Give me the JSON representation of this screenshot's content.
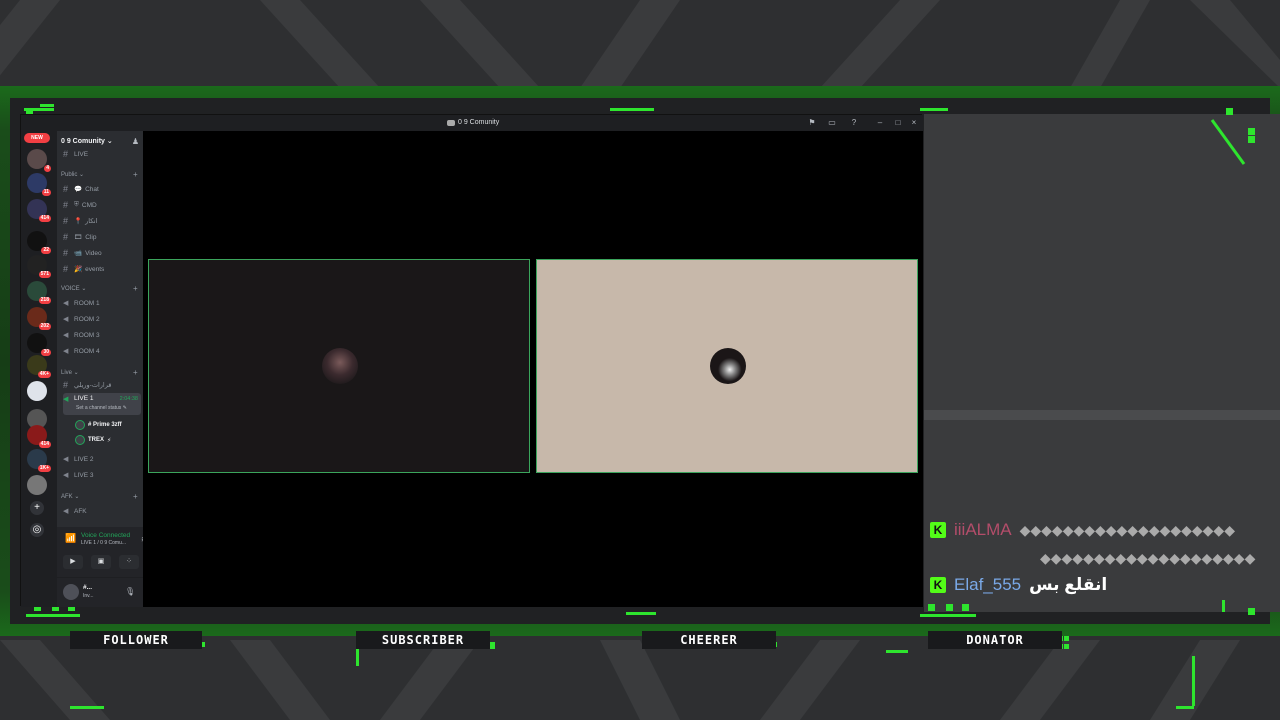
{
  "overlay": {
    "labels": [
      "FOLLOWER",
      "SUBSCRIBER",
      "CHEERER",
      "DONATOR"
    ],
    "accent": "#2ee52e"
  },
  "window": {
    "title": "0 9 Comunity",
    "controls": [
      "flag-icon",
      "inbox-icon",
      "help-icon",
      "minimize-icon",
      "maximize-icon",
      "close-icon"
    ]
  },
  "servers": {
    "new_label": "NEW",
    "badges": [
      "4",
      "11",
      "414",
      "22",
      "571",
      "218",
      "202",
      "30",
      "4K+",
      "414",
      "1K+"
    ]
  },
  "guild": {
    "name": "0 9 Comunity",
    "top_channel": "LIVE",
    "categories": [
      {
        "name": "Public",
        "channels": [
          "Chat",
          "CMD",
          "انكار",
          "Clip",
          "Video",
          "events"
        ]
      },
      {
        "name": "VOICE",
        "channels": [
          "ROOM 1",
          "ROOM 2",
          "ROOM 3",
          "ROOM 4"
        ]
      },
      {
        "name": "Live",
        "channels": [
          "قرارات-وريلي"
        ]
      },
      {
        "name": "AFK",
        "channels": [
          "AFK"
        ]
      }
    ],
    "active_voice": {
      "name": "LIVE 1",
      "timer": "2:04:38",
      "status": "Set a channel status"
    },
    "members": [
      "# Prime 3zff",
      "TREX"
    ],
    "other_live": [
      "LIVE 2",
      "LIVE 3"
    ]
  },
  "voice_panel": {
    "status": "Voice Connected",
    "location": "LIVE 1 / 0 9 Comu..."
  },
  "user_panel": {
    "name": "#...",
    "status": "Inv..."
  },
  "chat": [
    {
      "user": "iiiALMA",
      "message": "◆◆◆◆◆◆◆◆◆◆◆◆◆◆◆◆◆◆◆◆",
      "color": "#b34d6a"
    },
    {
      "user": "",
      "message": "◆◆◆◆◆◆◆◆◆◆◆◆◆◆◆◆◆◆◆◆",
      "color": "#aaaaaa"
    },
    {
      "user": "Elaf_555",
      "message": "انقلع بس",
      "color": "#7aa9e8"
    }
  ]
}
